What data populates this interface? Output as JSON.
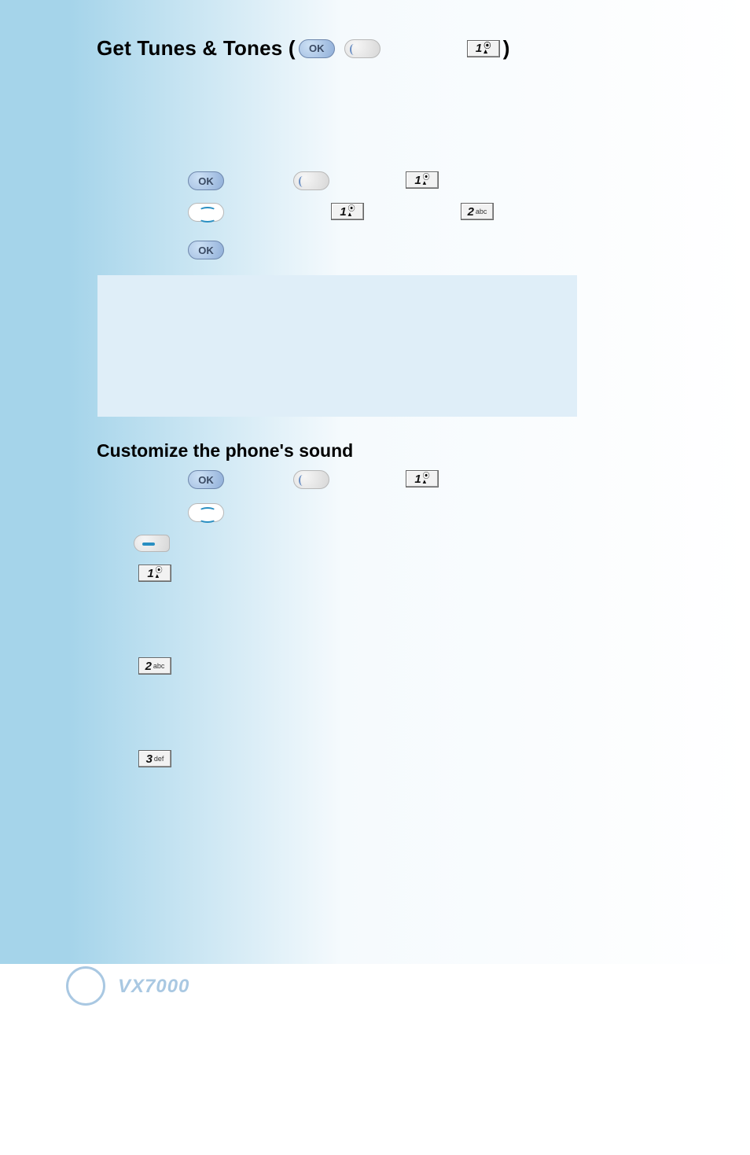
{
  "header": {
    "title_prefix": "Get Tunes & Tones (",
    "title_suffix": ")",
    "ok_label": "OK"
  },
  "keys": {
    "k1_num": "1",
    "k2_num": "2",
    "k2_label": "abc",
    "k3_num": "3",
    "k3_label": "def"
  },
  "section2": {
    "title": "Customize the phone's sound"
  },
  "footer": {
    "model": "VX7000"
  }
}
